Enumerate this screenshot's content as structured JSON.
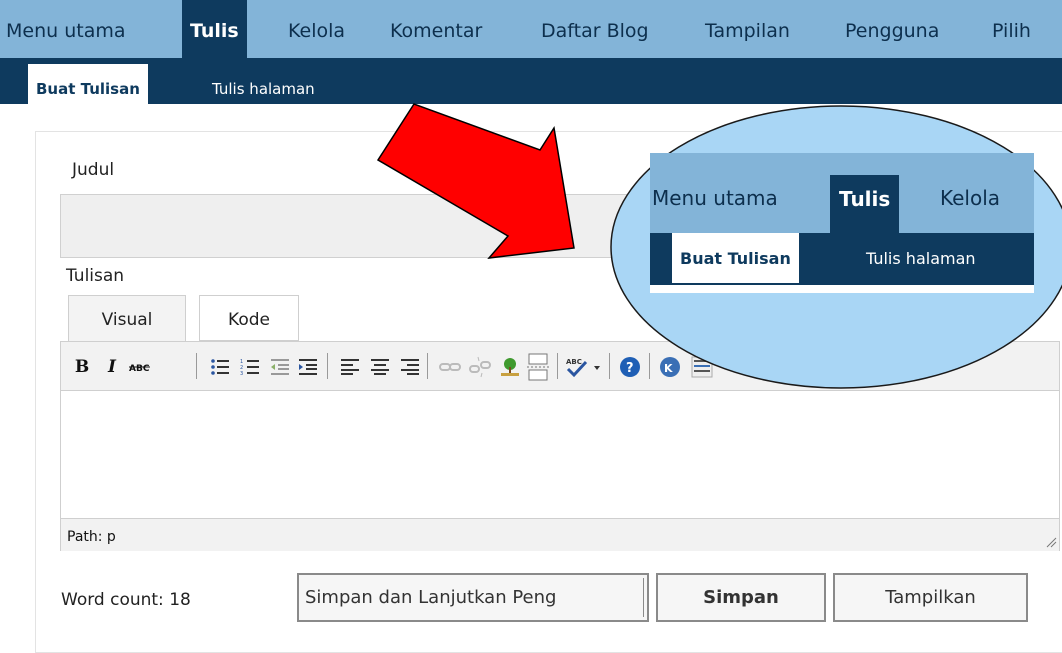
{
  "nav": {
    "items": [
      "Menu utama",
      "Tulis",
      "Kelola",
      "Komentar",
      "Daftar Blog",
      "Tampilan",
      "Pengguna",
      "Pilih"
    ],
    "active_index": 1
  },
  "subnav": {
    "items": [
      "Buat Tulisan",
      "Tulis halaman"
    ],
    "active_index": 0
  },
  "form": {
    "title_label": "Judul",
    "title_value": "",
    "body_label": "Tulisan",
    "tabs": [
      "Visual",
      "Kode"
    ],
    "active_tab": "Visual",
    "path": "Path: p",
    "word_count": "Word count: 18"
  },
  "toolbar": {
    "icons": [
      "bold-icon",
      "italic-icon",
      "strikethrough-icon",
      "bullet-list-icon",
      "numbered-list-icon",
      "outdent-icon",
      "indent-icon",
      "align-left-icon",
      "align-center-icon",
      "align-right-icon",
      "link-icon",
      "unlink-icon",
      "image-icon",
      "more-break-icon",
      "spellcheck-icon",
      "help-icon",
      "kitchen-sink-icon",
      "toggle-toolbar-icon"
    ]
  },
  "buttons": {
    "save_continue": "Simpan dan Lanjutkan Peng",
    "save": "Simpan",
    "preview": "Tampilkan"
  },
  "callout": {
    "nav_items": [
      "Menu utama",
      "Tulis",
      "Kelola"
    ],
    "subnav_items": [
      "Buat Tulisan",
      "Tulis halaman"
    ]
  },
  "colors": {
    "nav_bg": "#83b4d8",
    "nav_dark": "#0e3a5e",
    "arrow_red": "#ff0000",
    "ellipse_fill": "#a9d6f5"
  }
}
